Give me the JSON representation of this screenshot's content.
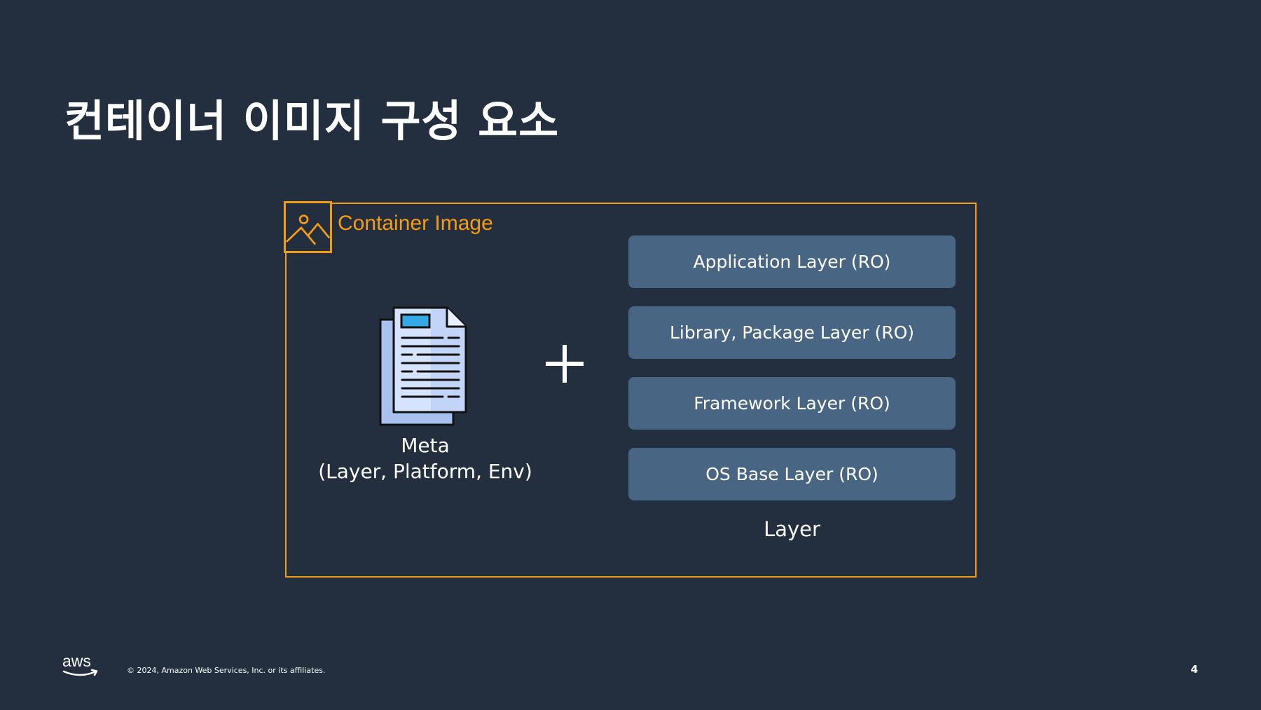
{
  "slide": {
    "title": "컨테이너 이미지 구성 요소",
    "page_number": "4",
    "copyright": "© 2024, Amazon Web Services, Inc. or its affiliates."
  },
  "diagram": {
    "container_label": "Container Image",
    "meta": {
      "line1": "Meta",
      "line2": "(Layer, Platform, Env)"
    },
    "layers": [
      "Application Layer (RO)",
      "Library, Package Layer (RO)",
      "Framework Layer (RO)",
      "OS Base Layer (RO)"
    ],
    "layers_caption": "Layer",
    "icons": {
      "container": "image-icon",
      "meta": "document-icon",
      "operator": "plus-icon",
      "brand": "aws-logo"
    }
  },
  "colors": {
    "background": "#232f3e",
    "accent": "#f59c12",
    "layer_fill": "#486583",
    "text": "#ffffff"
  }
}
